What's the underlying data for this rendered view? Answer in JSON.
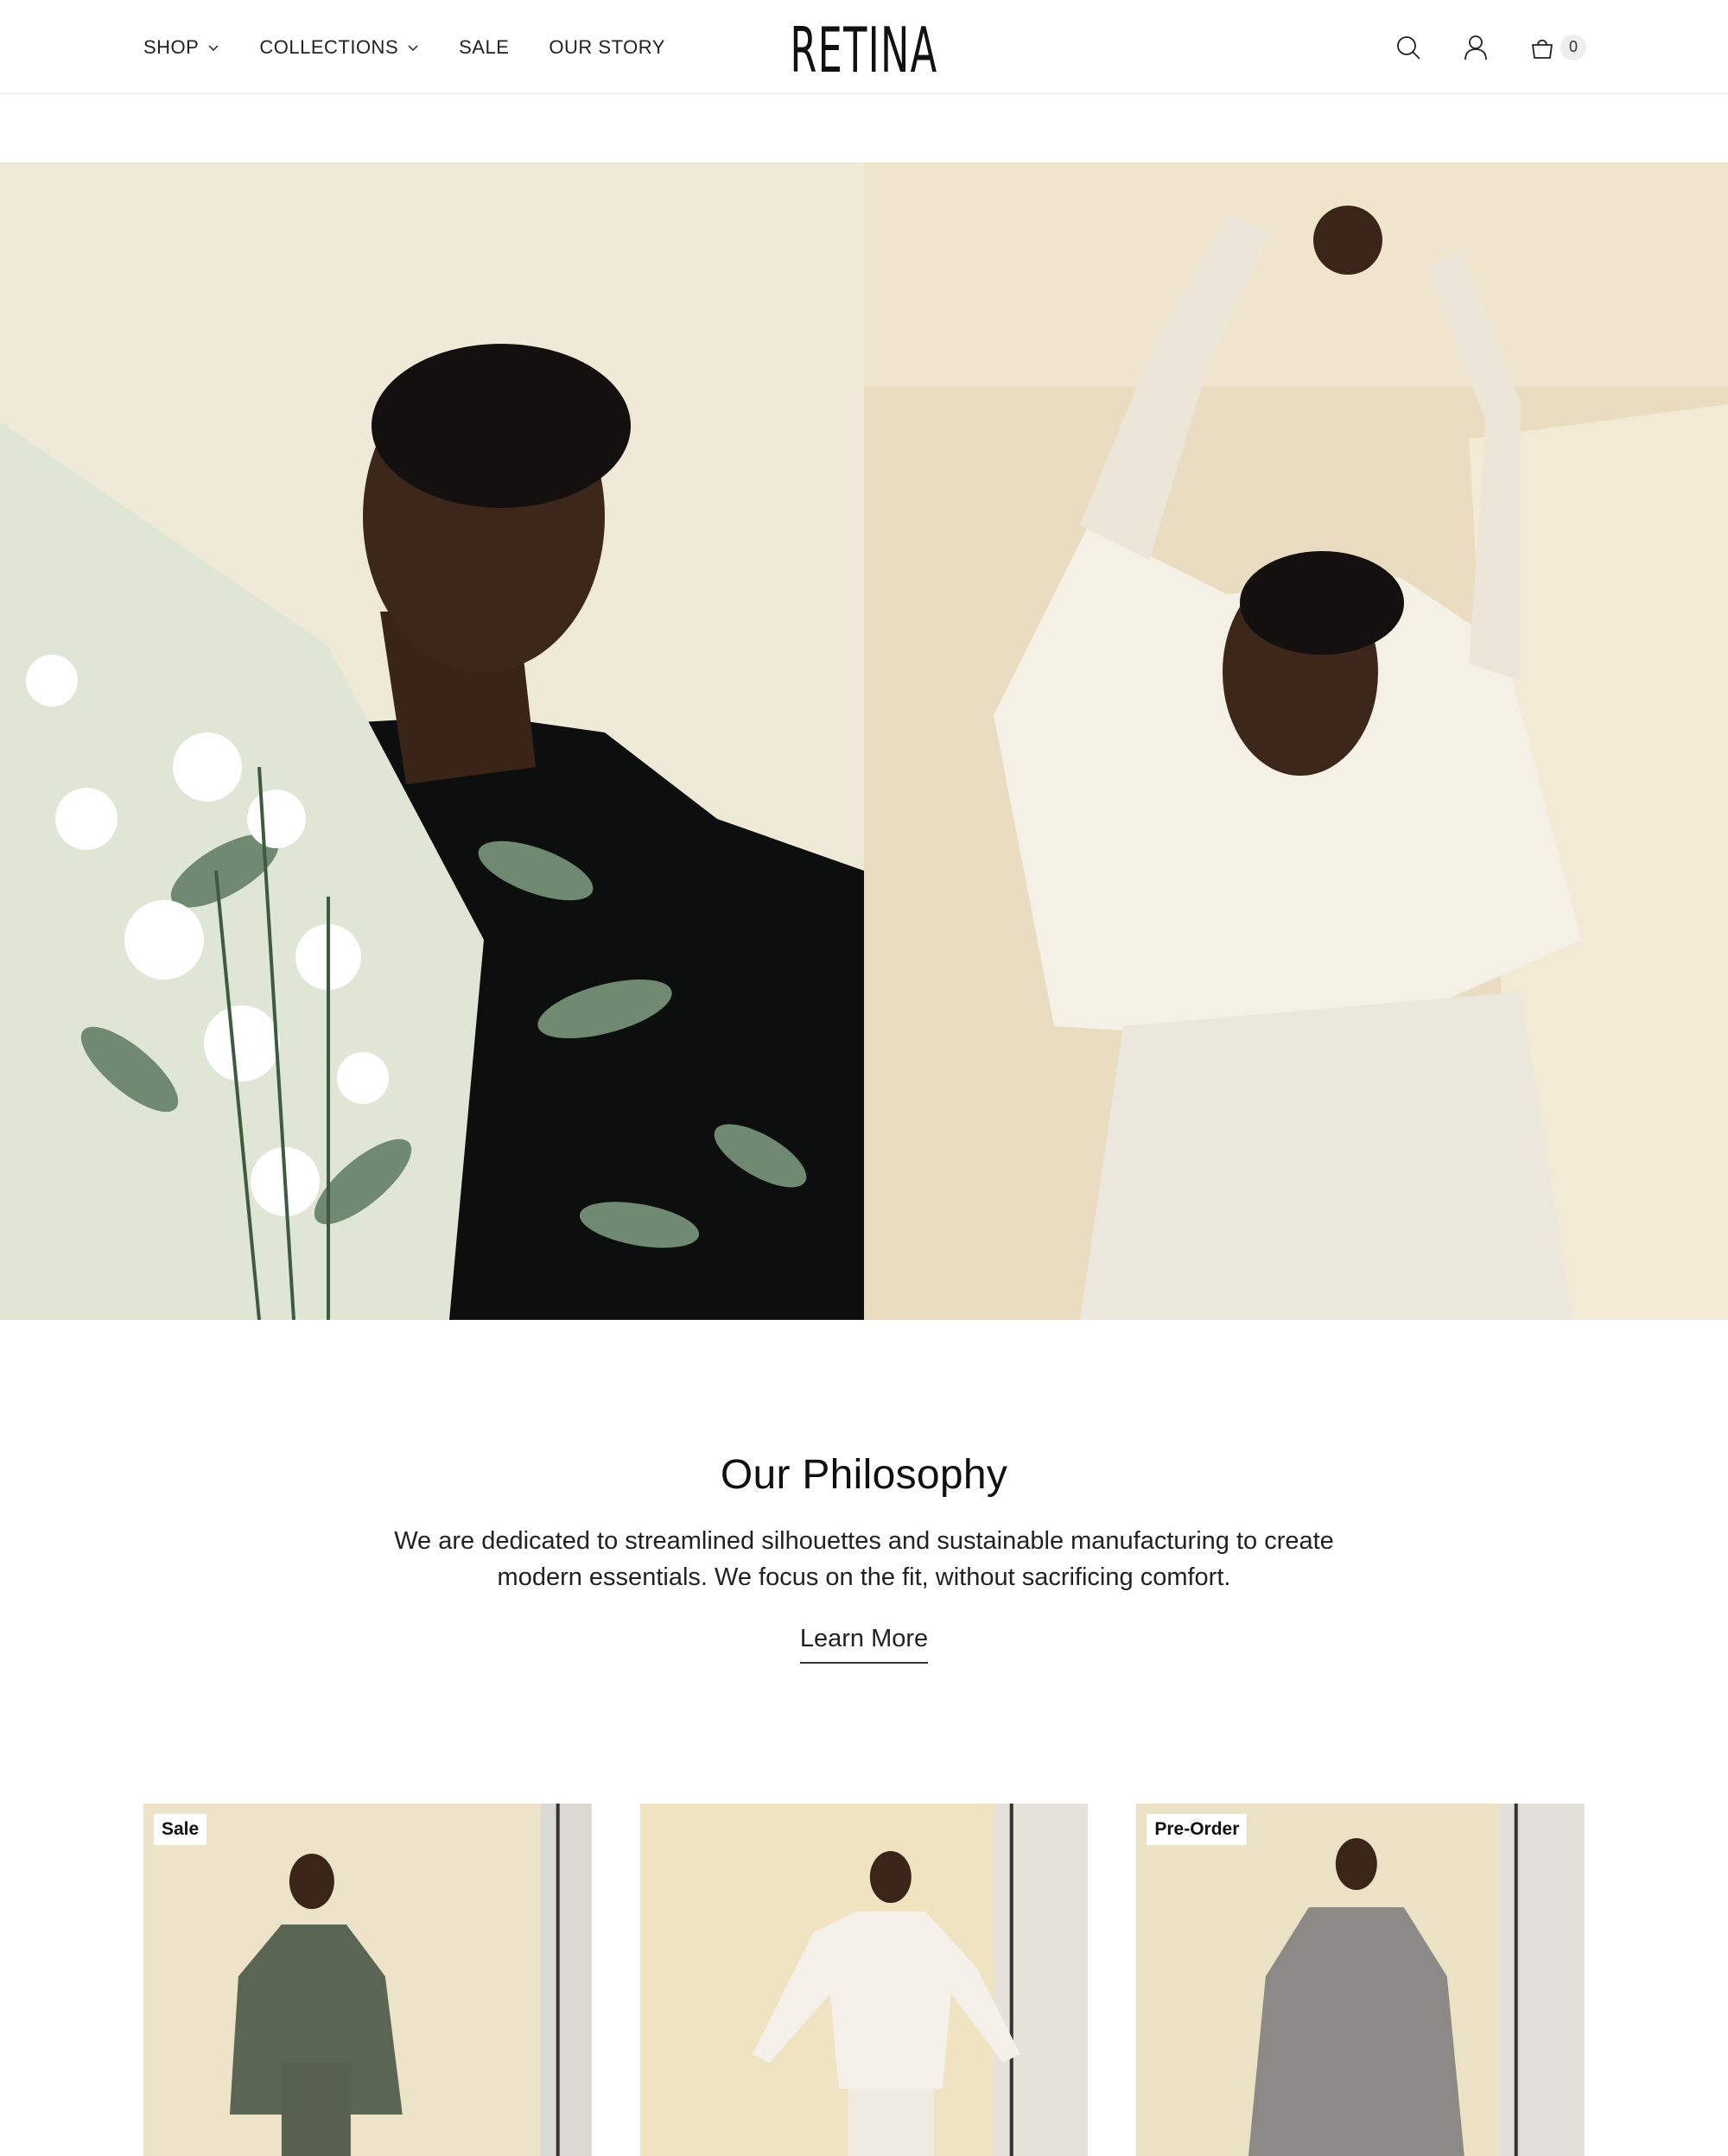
{
  "header": {
    "logo": "RETINA",
    "nav": [
      {
        "label": "SHOP",
        "dropdown": true
      },
      {
        "label": "COLLECTIONS",
        "dropdown": true
      },
      {
        "label": "SALE",
        "dropdown": false
      },
      {
        "label": "OUR STORY",
        "dropdown": false
      }
    ],
    "icons": [
      "search-icon",
      "account-icon",
      "cart-icon"
    ],
    "cart_count": "0"
  },
  "hero": {
    "images": [
      "woman-holding-bouquet-photo",
      "woman-stretching-arms-photo"
    ]
  },
  "philosophy": {
    "title": "Our Philosophy",
    "body": "We are dedicated to streamlined silhouettes and sustainable manufacturing to create modern essentials. We focus on the fit, without sacrificing comfort.",
    "link": "Learn More"
  },
  "products": [
    {
      "badge": "Sale",
      "image": "green-corduroy-top-photo"
    },
    {
      "badge": "",
      "image": "white-sweater-photo"
    },
    {
      "badge": "Pre-Order",
      "image": "grey-oversized-sweater-photo"
    }
  ],
  "colors": {
    "text": "#1a1a1a",
    "background": "#ffffff",
    "cream": "#efe6cf",
    "border": "#e6e6e6"
  }
}
